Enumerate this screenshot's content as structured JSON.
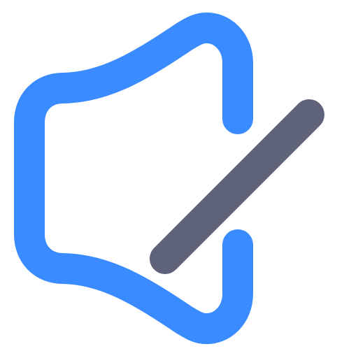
{
  "icon": {
    "name": "speaker-mute-icon",
    "colors": {
      "speaker": "#3A8BFF",
      "slash": "#5F6379",
      "background": "#FFFFFF"
    }
  }
}
